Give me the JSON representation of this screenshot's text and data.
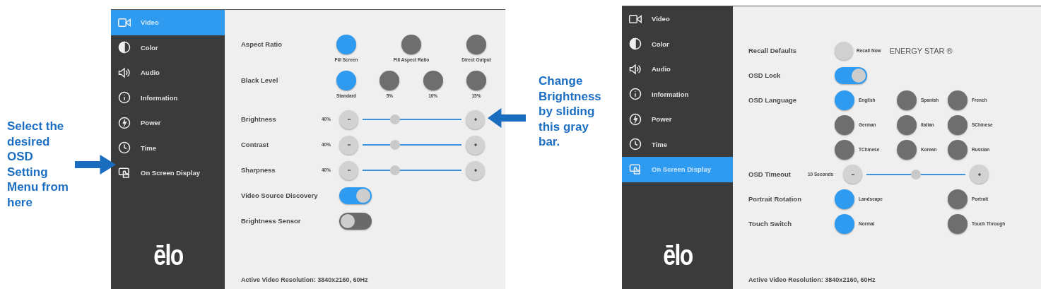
{
  "callouts": [
    {
      "text": "Select the desired OSD Setting Menu from here"
    },
    {
      "text": "Change Brightness by sliding this gray bar."
    }
  ],
  "screens": [
    {
      "sidebar": {
        "items": [
          {
            "label": "Video",
            "selected": true
          },
          {
            "label": "Color",
            "selected": false
          },
          {
            "label": "Audio",
            "selected": false
          },
          {
            "label": "Information",
            "selected": false
          },
          {
            "label": "Power",
            "selected": false
          },
          {
            "label": "Time",
            "selected": false
          },
          {
            "label": "On Screen Display",
            "selected": false
          }
        ]
      },
      "logo": "ēlo",
      "settings": [
        {
          "kind": "options",
          "label": "Aspect Ratio",
          "options": [
            {
              "label": "Fill Screen",
              "selected": true
            },
            {
              "label": "Fill Aspect Ratio",
              "selected": false
            },
            {
              "label": "Direct Output",
              "selected": false
            }
          ]
        },
        {
          "kind": "options",
          "label": "Black Level",
          "options": [
            {
              "label": "Standard",
              "selected": true
            },
            {
              "label": "5%",
              "selected": false
            },
            {
              "label": "10%",
              "selected": false
            },
            {
              "label": "15%",
              "selected": false
            }
          ]
        },
        {
          "kind": "slider",
          "label": "Brightness",
          "reading": "40%",
          "level": 0.33
        },
        {
          "kind": "slider",
          "label": "Contrast",
          "reading": "40%",
          "level": 0.33
        },
        {
          "kind": "slider",
          "label": "Sharpness",
          "reading": "40%",
          "level": 0.33
        },
        {
          "kind": "toggle",
          "label": "Video Source Discovery",
          "on": true
        },
        {
          "kind": "toggle",
          "label": "Brightness Sensor",
          "on": false
        }
      ],
      "footer": "Active Video Resolution: 3840x2160, 60Hz"
    },
    {
      "sidebar": {
        "items": [
          {
            "label": "Video",
            "selected": false
          },
          {
            "label": "Color",
            "selected": false
          },
          {
            "label": "Audio",
            "selected": false
          },
          {
            "label": "Information",
            "selected": false
          },
          {
            "label": "Power",
            "selected": false
          },
          {
            "label": "Time",
            "selected": false
          },
          {
            "label": "On Screen Display",
            "selected": true
          }
        ]
      },
      "logo": "ēlo",
      "settings": [
        {
          "kind": "action",
          "label": "Recall Defaults",
          "button_label": "Recall Now",
          "note": "ENERGY STAR ®"
        },
        {
          "kind": "toggle",
          "label": "OSD Lock",
          "on": true
        },
        {
          "kind": "options",
          "label": "OSD Language",
          "options": [
            {
              "label": "English",
              "selected": true
            },
            {
              "label": "Spanish",
              "selected": false
            },
            {
              "label": "French",
              "selected": false
            },
            {
              "label": "German",
              "selected": false
            },
            {
              "label": "Italian",
              "selected": false
            },
            {
              "label": "SChinese",
              "selected": false
            },
            {
              "label": "TChinese",
              "selected": false
            },
            {
              "label": "Korean",
              "selected": false
            },
            {
              "label": "Russian",
              "selected": false
            }
          ]
        },
        {
          "kind": "slider",
          "label": "OSD Timeout",
          "reading": "10 Seconds",
          "level": 0.5
        },
        {
          "kind": "options",
          "label": "Portrait Rotation",
          "options": [
            {
              "label": "Landscape",
              "selected": true
            },
            {
              "label": "Portrait",
              "selected": false
            }
          ]
        },
        {
          "kind": "options",
          "label": "Touch Switch",
          "options": [
            {
              "label": "Normal",
              "selected": true
            },
            {
              "label": "Touch Through",
              "selected": false
            }
          ]
        }
      ],
      "footer": "Active Video Resolution: 3840x2160, 60Hz"
    }
  ]
}
